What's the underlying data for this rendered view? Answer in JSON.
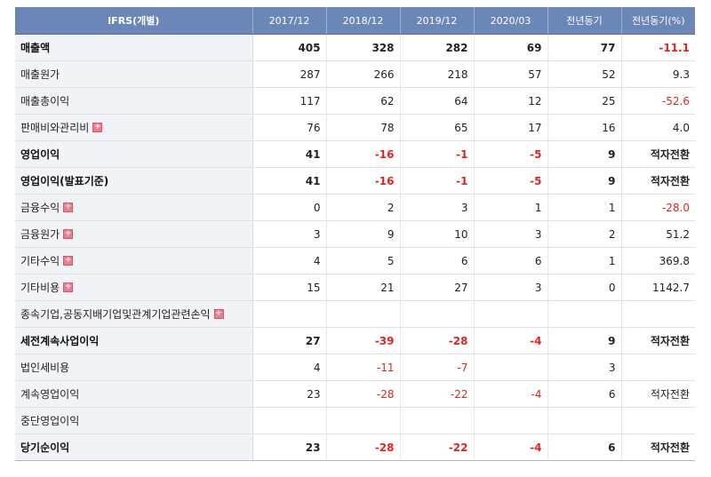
{
  "table": {
    "headers": [
      "IFRS(개별)",
      "2017/12",
      "2018/12",
      "2019/12",
      "2020/03",
      "전년동기",
      "전년동기(%)"
    ],
    "rows": [
      {
        "label": "매출액",
        "bold": true,
        "expand": false,
        "cells": [
          "405",
          "328",
          "282",
          "69",
          "77",
          "-11.1"
        ]
      },
      {
        "label": "매출원가",
        "bold": false,
        "expand": false,
        "cells": [
          "287",
          "266",
          "218",
          "57",
          "52",
          "9.3"
        ]
      },
      {
        "label": "매출총이익",
        "bold": false,
        "expand": false,
        "cells": [
          "117",
          "62",
          "64",
          "12",
          "25",
          "-52.6"
        ]
      },
      {
        "label": "판매비와관리비",
        "bold": false,
        "expand": true,
        "cells": [
          "76",
          "78",
          "65",
          "17",
          "16",
          "4.0"
        ]
      },
      {
        "label": "영업이익",
        "bold": true,
        "expand": false,
        "cells": [
          "41",
          "-16",
          "-1",
          "-5",
          "9",
          "적자전환"
        ]
      },
      {
        "label": "영업이익(발표기준)",
        "bold": true,
        "expand": false,
        "cells": [
          "41",
          "-16",
          "-1",
          "-5",
          "9",
          "적자전환"
        ]
      },
      {
        "label": "금융수익",
        "bold": false,
        "expand": true,
        "cells": [
          "0",
          "2",
          "3",
          "1",
          "1",
          "-28.0"
        ]
      },
      {
        "label": "금융원가",
        "bold": false,
        "expand": true,
        "cells": [
          "3",
          "9",
          "10",
          "3",
          "2",
          "51.2"
        ]
      },
      {
        "label": "기타수익",
        "bold": false,
        "expand": true,
        "cells": [
          "4",
          "5",
          "6",
          "6",
          "1",
          "369.8"
        ]
      },
      {
        "label": "기타비용",
        "bold": false,
        "expand": true,
        "cells": [
          "15",
          "21",
          "27",
          "3",
          "0",
          "1142.7"
        ]
      },
      {
        "label": "종속기업,공동지배기업및관계기업관련손익",
        "bold": false,
        "expand": true,
        "cells": [
          "",
          "",
          "",
          "",
          "",
          ""
        ]
      },
      {
        "label": "세전계속사업이익",
        "bold": true,
        "expand": false,
        "cells": [
          "27",
          "-39",
          "-28",
          "-4",
          "9",
          "적자전환"
        ]
      },
      {
        "label": "법인세비용",
        "bold": false,
        "expand": false,
        "cells": [
          "4",
          "-11",
          "-7",
          "",
          "3",
          ""
        ]
      },
      {
        "label": "계속영업이익",
        "bold": false,
        "expand": false,
        "cells": [
          "23",
          "-28",
          "-22",
          "-4",
          "6",
          "적자전환"
        ]
      },
      {
        "label": "중단영업이익",
        "bold": false,
        "expand": false,
        "cells": [
          "",
          "",
          "",
          "",
          "",
          ""
        ]
      },
      {
        "label": "당기순이익",
        "bold": true,
        "expand": false,
        "cells": [
          "23",
          "-28",
          "-22",
          "-4",
          "6",
          "적자전환"
        ]
      }
    ],
    "expand_icon": "plus-icon",
    "negative_color": "#e0251e",
    "header_color": "#6b87b7"
  }
}
